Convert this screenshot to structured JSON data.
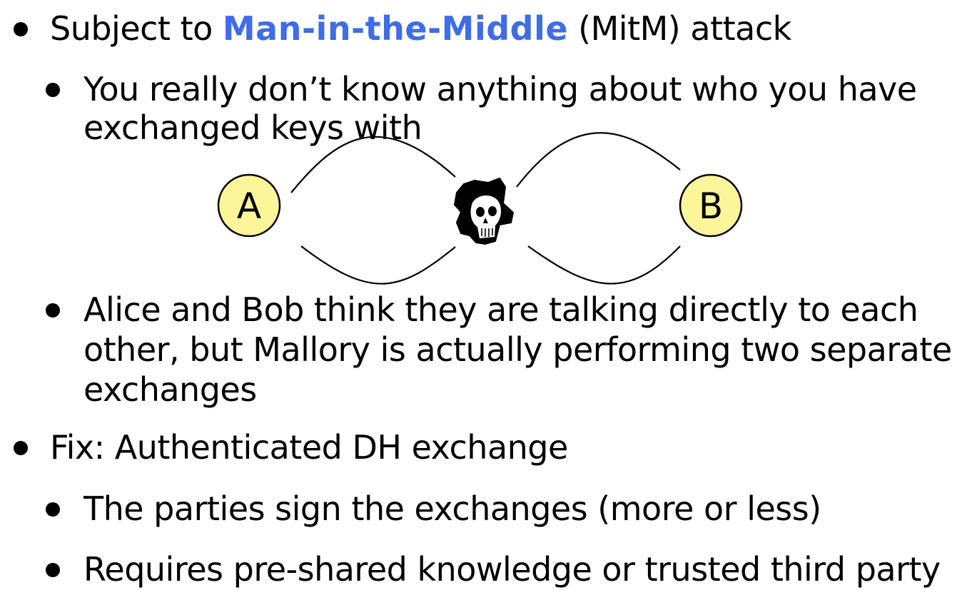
{
  "bullets": {
    "b1": {
      "prefix": "Subject to ",
      "highlight": "Man-in-the-Middle",
      "suffix": " (MitM) attack"
    },
    "b1_1": {
      "line1": "You really don’t know anything about who you have",
      "line2": "exchanged keys with"
    },
    "b1_2": {
      "line1": "Alice and Bob think they are talking directly to each",
      "line2": "other, but Mallory is actually performing two separate",
      "line3": "exchanges"
    },
    "b2": {
      "text": "Fix: Authenticated DH exchange"
    },
    "b2_1": {
      "text": "The parties sign the exchanges (more or less)"
    },
    "b2_2": {
      "text": "Requires pre-shared knowledge or trusted third party"
    }
  },
  "diagram": {
    "node_a": "A",
    "node_b": "B",
    "attacker_icon": "skull-icon",
    "node_fill": "#fdf59a",
    "accent_color": "#3f6de6"
  }
}
